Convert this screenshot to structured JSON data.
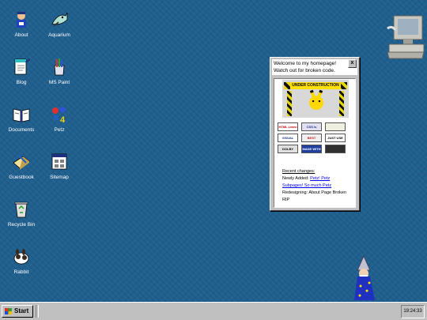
{
  "desktop": {
    "icons": [
      {
        "label": "About",
        "icon": "person-icon"
      },
      {
        "label": "Aquarium",
        "icon": "fish-icon"
      },
      {
        "label": "Blog",
        "icon": "notepad-icon"
      },
      {
        "label": "MS Paint",
        "icon": "paint-icon"
      },
      {
        "label": "Documents",
        "icon": "book-icon"
      },
      {
        "label": "Petz",
        "icon": "dice-icon"
      },
      {
        "label": "Guestbook",
        "icon": "guestbook-icon"
      },
      {
        "label": "Sitemap",
        "icon": "sitemap-icon"
      },
      {
        "label": "Recycle Bin",
        "icon": "recycle-bin-icon"
      },
      {
        "label": "Rabbit",
        "icon": "rabbit-icon"
      }
    ]
  },
  "popup": {
    "title": "Welcome to my homepage! Watch out for broken code.",
    "close_label": "x",
    "banner_text": "UNDER CONSTRUCTION",
    "badges": [
      "HTML Learn Code",
      "CSS is difficult",
      "",
      "VISUAL STUDIO Code",
      "BEST VIEWED",
      "JUST USE PN",
      "DOLBY 800x600",
      "MADE WITH A COMPUTER",
      ""
    ],
    "changes_heading": "Recent changes:",
    "changes": [
      {
        "prefix": "Newly Added: ",
        "link": "Petz! Petz"
      },
      {
        "prefix": "",
        "link": "Subpages! So much Petz"
      },
      {
        "prefix": "Redesigning: About Page Broken",
        "link": ""
      },
      {
        "prefix": "RIP",
        "link": ""
      }
    ]
  },
  "taskbar": {
    "start_label": "Start",
    "clock": "19:24:33"
  },
  "colors": {
    "desktop": "#1f5f8e",
    "window_face": "#c0c0c0",
    "link": "#0000ee"
  }
}
